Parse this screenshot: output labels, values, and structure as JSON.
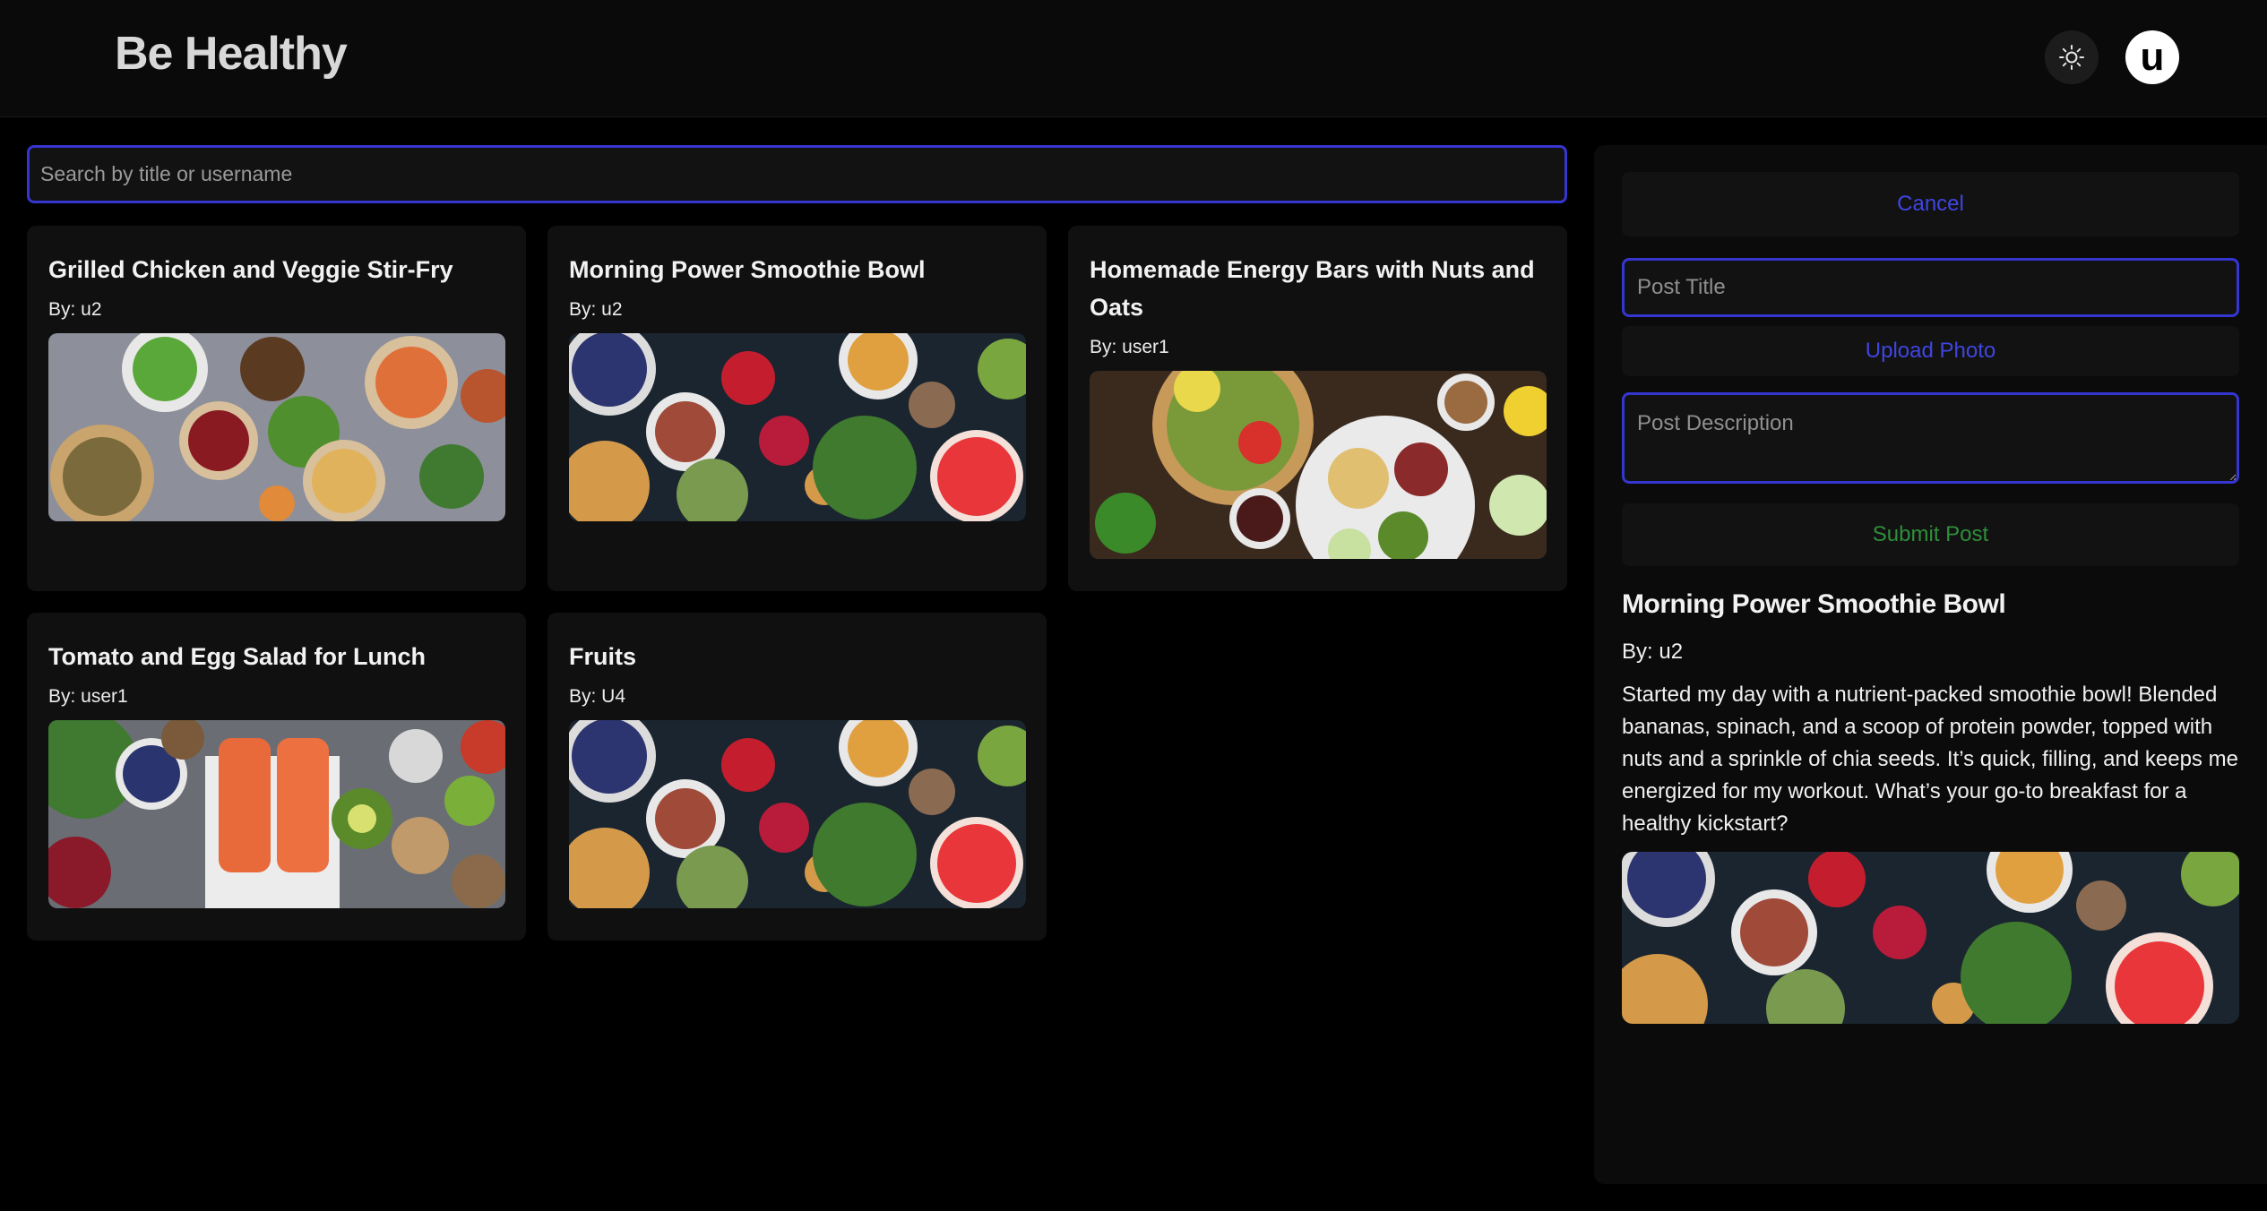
{
  "header": {
    "app_title": "Be Healthy",
    "theme_icon": "sun-icon",
    "avatar_letter": "u"
  },
  "search": {
    "placeholder": "Search by title or username"
  },
  "posts": [
    {
      "title": "Grilled Chicken and Veggie Stir-Fry",
      "author": "By: u2",
      "image": "food-spread-bowls-photo"
    },
    {
      "title": "Morning Power Smoothie Bowl",
      "author": "By: u2",
      "image": "smoothie-ingredients-photo"
    },
    {
      "title": "Homemade Energy Bars with Nuts and Oats",
      "author": "By: user1",
      "image": "salad-platter-photo"
    },
    {
      "title": "Tomato and Egg Salad for Lunch",
      "author": "By: user1",
      "image": "salmon-and-superfoods-photo"
    },
    {
      "title": "Fruits",
      "author": "By: U4",
      "image": "smoothie-ingredients-photo"
    }
  ],
  "form": {
    "cancel_label": "Cancel",
    "title_placeholder": "Post Title",
    "upload_label": "Upload Photo",
    "description_placeholder": "Post Description",
    "submit_label": "Submit Post"
  },
  "detail": {
    "title": "Morning Power Smoothie Bowl",
    "author": "By: u2",
    "body": "Started my day with a nutrient-packed smoothie bowl! Blended bananas, spinach, and a scoop of protein powder, topped with nuts and a sprinkle of chia seeds. It’s quick, filling, and keeps me energized for my workout. What’s your go-to breakfast for a healthy kickstart?",
    "image": "smoothie-ingredients-photo"
  },
  "colors": {
    "accent_blue": "#3535d0",
    "link_blue": "#3f46e0",
    "submit_green": "#2f8f3a",
    "background": "#000000",
    "card": "#101010"
  }
}
